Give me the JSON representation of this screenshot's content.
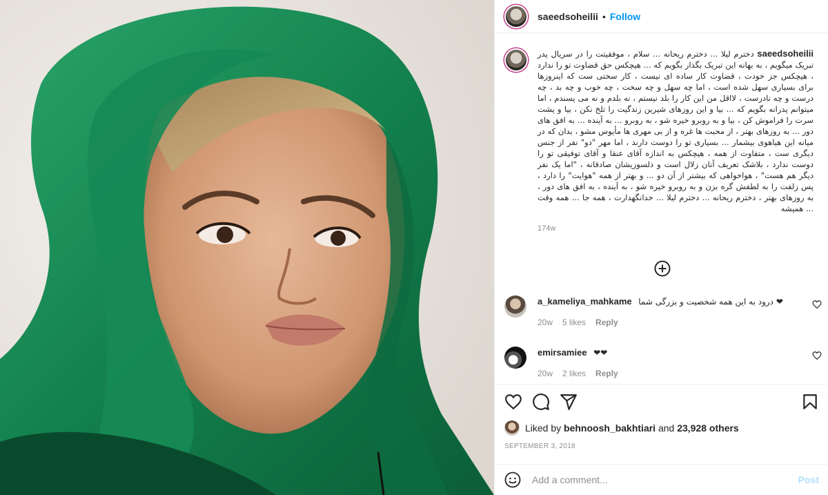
{
  "post": {
    "author": "saeedsoheilii",
    "follow_label": "Follow",
    "separator": "•",
    "photo_alt": "Portrait photo"
  },
  "caption": {
    "username": "saeedsoheilii",
    "text": "دخترم لیلا ... دخترم ریحانه ... سلام ، موفقیتت را در سریال پدر تبریک میگویم ، به بهانه این تبریک بگذار بگویم که ... هیچکس حق قضاوت تو را ندارد ، هیچکس جز خودت ، قضاوت کار ساده ای نیست ، کار سختی ست که اینروزها برای بسیاری سهل شده است ، اما چه سهل و چه سخت ، چه خوب و چه بد ، چه درست و چه نادرست ، لااقل من این کار را بلد نیستم ، نه بلدم و نه می پسندم ، اما میتوانم پدرانه بگویم که ... بیا و این روزهای شیرین زندگیت را تلخ نکن ، بیا و پشت سرت را فراموش کن ، بیا و به روبرو خیره شو ، به روبرو ... به آینده ... به افق های دور ... به روزهای بهتر ، از محبت ها غره و از بی مهری ها مأیوس مشو ، بدان که در میانه این هیاهوی بیشمار ... بسیاری تو را دوست دارند ، اما مهر \"دو\" نفر از جنس دیگری ست ، متفاوت از همه ، هیچکس به اندازه آقای عنقا و آقای توفیقی تو را دوست ندارد ، بلاشک تعریف آنان زلال است و دلسوزیشان صادقانه ، \"اما یک نفر دیگر هم هست\" ، هواخواهی که بیشتر از آن دو ... و بهتر از همه \"هوایت\" را دارد ، پس زلفت را به لطفش گره بزن و به روبرو خیره شو ، به آینده ، به افق های دور ، به روزهای بهتر ، دخترم ریحانه ... دخترم لیلا ... خدانگهدارت ، همه جا ... همه وقت ... همیشه",
    "time": "174w"
  },
  "comments": [
    {
      "username": "a_kameliya_mahkame",
      "text": "درود به این همه شخصیت و بزرگی شما ❤",
      "time": "20w",
      "likes": "5 likes",
      "reply_label": "Reply"
    },
    {
      "username": "emirsamiee",
      "text": "❤❤",
      "time": "20w",
      "likes": "2 likes",
      "reply_label": "Reply"
    }
  ],
  "likes": {
    "prefix": "Liked by",
    "user": "behnoosh_bakhtiari",
    "middle": "and",
    "others": "23,928 others"
  },
  "date": "SEPTEMBER 3, 2018",
  "add_comment": {
    "placeholder": "Add a comment...",
    "post_label": "Post"
  },
  "colors": {
    "accent": "#0095f6",
    "post_disabled": "#b2dffc",
    "muted": "#8e8e8e",
    "scarf_green": "#1f8a55"
  },
  "icons": {
    "load_more": "plus-circle-icon",
    "like": "heart-icon",
    "comment": "comment-icon",
    "share": "paper-plane-icon",
    "save": "bookmark-icon",
    "emoji": "smiley-icon"
  }
}
